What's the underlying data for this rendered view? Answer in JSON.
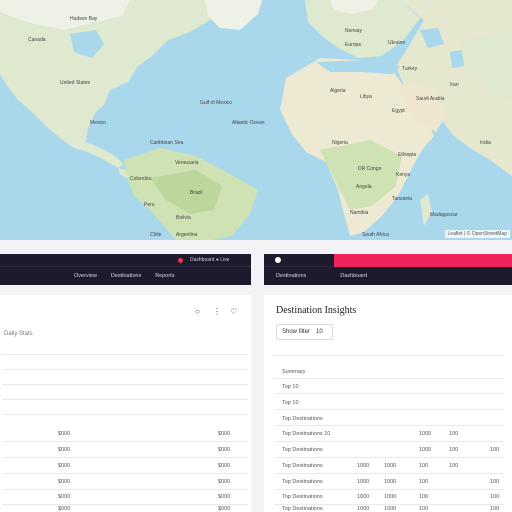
{
  "map": {
    "attribution": "Leaflet | © OpenStreetMap",
    "labels": [
      "Canada",
      "Hudson Bay",
      "United States",
      "Gulf of Mexico",
      "Mexico",
      "Caribbean Sea",
      "Venezuela",
      "Colombia",
      "Brazil",
      "Peru",
      "Bolivia",
      "Argentina",
      "Chile",
      "Atlantic Ocean",
      "Norway",
      "Europe",
      "Ukraine",
      "Turkey",
      "Algeria",
      "Libya",
      "Egypt",
      "Saudi Arabia",
      "Iran",
      "Nigeria",
      "Ethiopia",
      "DR Congo",
      "Kenya",
      "Angola",
      "Tanzania",
      "Namibia",
      "South Africa",
      "Madagascar",
      "India"
    ]
  },
  "left_panel": {
    "nav_tag": "Dashboard ● Live",
    "nav_links": [
      "Overview",
      "Destinations",
      "Reports"
    ],
    "heading": "Daily Stats",
    "location_icon": "map-pin-icon",
    "share_icon": "share-icon",
    "rows": [
      {
        "a": "$000",
        "b": "$000"
      },
      {
        "a": "$000",
        "b": "$000"
      },
      {
        "a": "$000",
        "b": "$000"
      },
      {
        "a": "$000",
        "b": "$000"
      },
      {
        "a": "$000",
        "b": "$000"
      },
      {
        "a": "$000",
        "b": "$000"
      }
    ]
  },
  "right_panel": {
    "nav_links": [
      "Destinations",
      "Dashboard"
    ],
    "title": "Destination Insights",
    "filter_label": "Show filter",
    "filter_count": "10",
    "labels": [
      "Summary",
      "Top 10",
      "Top 10",
      "Top Destinations",
      "Top Destinations 10",
      "Top Destinations",
      "Top Destinations",
      "Top Destinations",
      "Top Destinations",
      "Top Destinations"
    ],
    "col2": [
      "",
      "",
      "",
      "",
      "",
      "",
      "1000",
      "1000",
      "1000",
      "1000"
    ],
    "col3": [
      "",
      "",
      "",
      "",
      "1000",
      "1000",
      "1000",
      "1000",
      "1000",
      "1000"
    ],
    "col4": [
      "",
      "",
      "",
      "",
      "100",
      "100",
      "100",
      "100",
      "100",
      "100"
    ],
    "col5": [
      "",
      "",
      "",
      "",
      "",
      "100",
      "100",
      "100",
      "100",
      "100"
    ]
  },
  "colors": {
    "nav_dark": "#1d1a2e",
    "accent": "#f0245a",
    "red_dot": "#e83a4f",
    "ocean": "#a9d7ec",
    "land": "#dbe9c6"
  }
}
